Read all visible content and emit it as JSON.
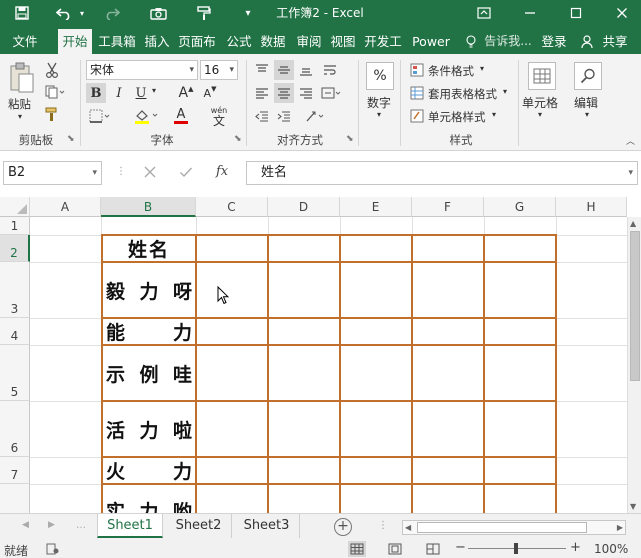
{
  "window": {
    "title": "工作簿2 - Excel"
  },
  "qat": {
    "save": "save-icon",
    "undo": "undo-icon",
    "redo": "redo-icon",
    "camera": "camera-icon",
    "format_painter": "format-painter-icon",
    "customize": "▾"
  },
  "tabs": [
    "文件",
    "开始",
    "工具箱",
    "插入",
    "页面布",
    "公式",
    "数据",
    "审阅",
    "视图",
    "开发工",
    "Power"
  ],
  "tellme": "告诉我...",
  "login": "登录",
  "share": "共享",
  "ribbon": {
    "clipboard": {
      "paste": "粘贴",
      "label": "剪贴板"
    },
    "font": {
      "name": "宋体",
      "size": "16",
      "bold": "B",
      "italic": "I",
      "underline": "U",
      "grow": "A",
      "shrink": "A",
      "color_a": "A",
      "wen": "wén",
      "wen_char": "文",
      "label": "字体"
    },
    "alignment": {
      "label": "对齐方式"
    },
    "number": {
      "symbol": "%",
      "label": "数字"
    },
    "styles": {
      "cond": "条件格式",
      "table": "套用表格格式",
      "cell": "单元格样式",
      "label": "样式"
    },
    "cells": {
      "label": "单元格"
    },
    "editing": {
      "label": "编辑"
    }
  },
  "formula_bar": {
    "name_box": "B2",
    "fx": "fx",
    "content": "姓名"
  },
  "grid": {
    "columns": [
      "A",
      "B",
      "C",
      "D",
      "E",
      "F",
      "G",
      "H"
    ],
    "rows": [
      "1",
      "2",
      "3",
      "4",
      "5",
      "6",
      "7"
    ],
    "names": [
      {
        "row": "2",
        "chars": [
          "姓名"
        ]
      },
      {
        "row": "3",
        "chars": [
          "毅",
          "力",
          "呀"
        ]
      },
      {
        "row": "4",
        "chars": [
          "能",
          "力"
        ]
      },
      {
        "row": "5",
        "chars": [
          "示",
          "例",
          "哇"
        ]
      },
      {
        "row": "6",
        "chars": [
          "活",
          "力",
          "啦"
        ]
      },
      {
        "row": "7",
        "chars": [
          "火",
          "力"
        ]
      },
      {
        "row": "8",
        "chars": [
          "实",
          "力",
          "哟"
        ]
      }
    ]
  },
  "sheets": [
    "Sheet1",
    "Sheet2",
    "Sheet3"
  ],
  "status": {
    "ready": "就绪",
    "zoom": "100%"
  },
  "colors": {
    "accent": "#217346",
    "border": "#c0702c"
  }
}
